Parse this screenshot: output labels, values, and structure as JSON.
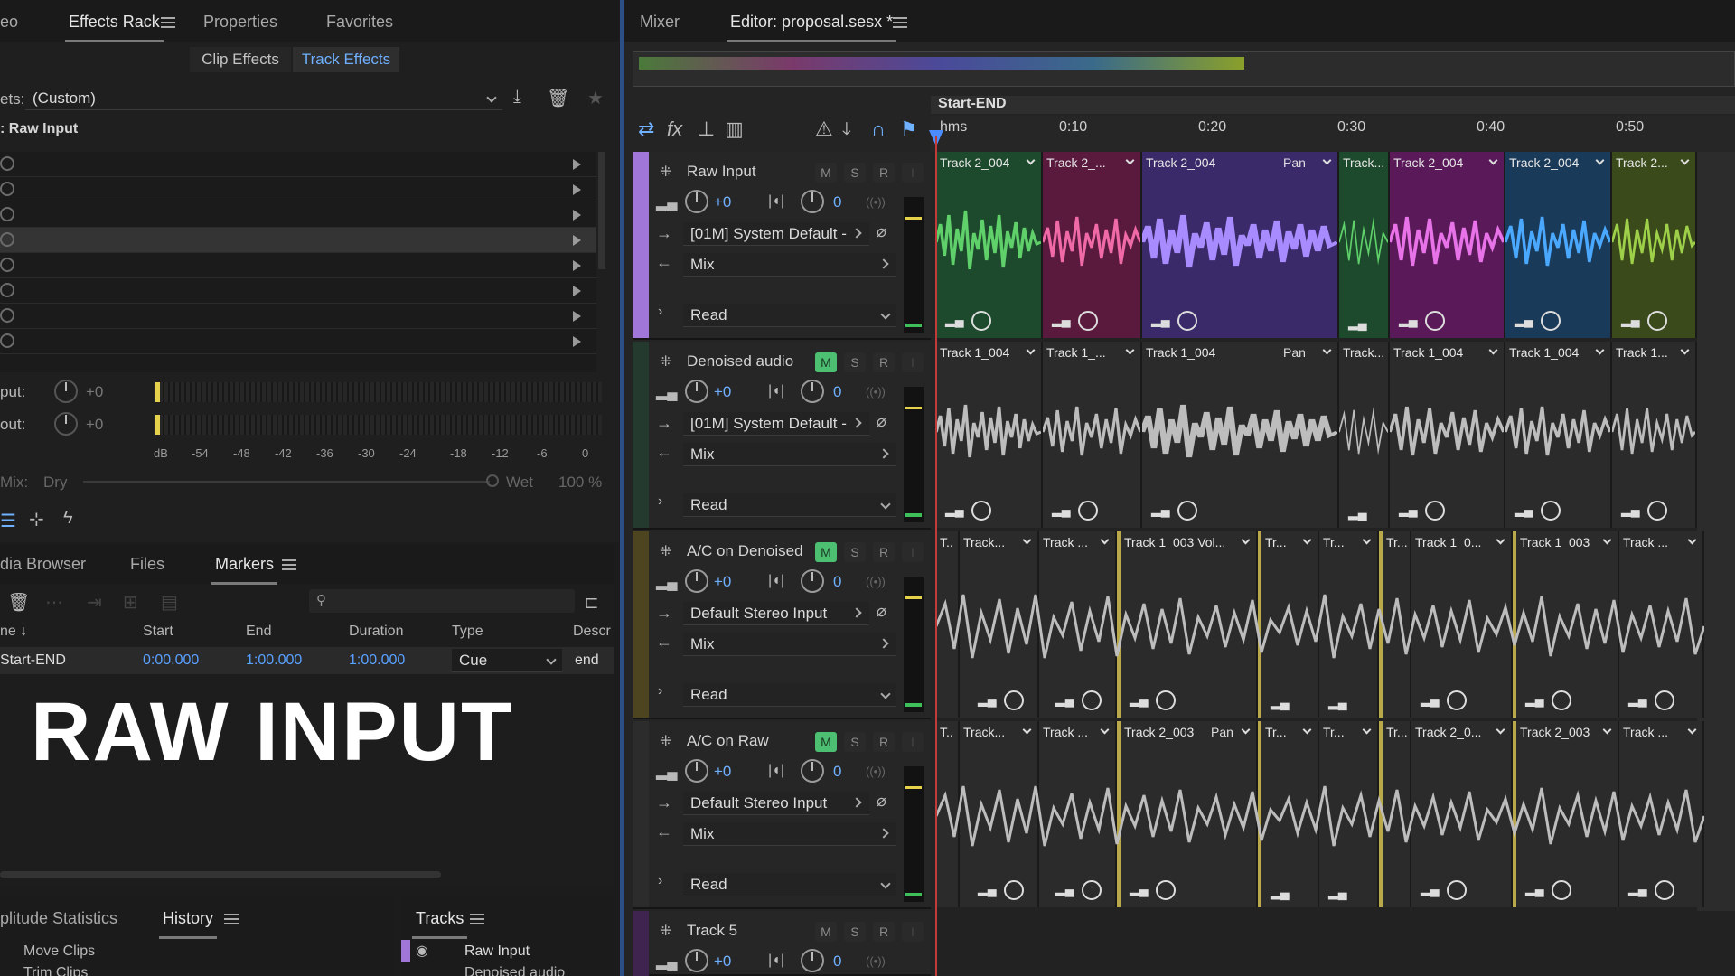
{
  "left_tabs": {
    "video": "eo",
    "effects_rack": "Effects Rack",
    "properties": "Properties",
    "favorites": "Favorites"
  },
  "subtabs": {
    "clip": "Clip Effects",
    "track": "Track Effects"
  },
  "presets": {
    "label": "ets:",
    "value": "(Custom)"
  },
  "rack_title": ": Raw Input",
  "io": {
    "input_label": "put:",
    "output_label": "out:",
    "input_val": "+0",
    "output_val": "+0"
  },
  "meter_scale": [
    "dB",
    "-54",
    "-48",
    "-42",
    "-36",
    "-30",
    "-24",
    "-18",
    "-12",
    "-6",
    "0"
  ],
  "mix": {
    "label": "Mix:",
    "dry": "Dry",
    "wet": "Wet",
    "pct": "100 %"
  },
  "bottom_tabs": {
    "media": "dia Browser",
    "files": "Files",
    "markers": "Markers"
  },
  "markers": {
    "headers": [
      "ne ↓",
      "Start",
      "End",
      "Duration",
      "Type",
      "Descr"
    ],
    "row": {
      "name": "Start-END",
      "start": "0:00.000",
      "end": "1:00.000",
      "duration": "1:00.000",
      "type": "Cue",
      "desc": "end"
    }
  },
  "overlay": "RAW INPUT",
  "lower_tabs": {
    "amp": "plitude Statistics",
    "history": "History",
    "tracks": "Tracks"
  },
  "history": [
    "Move Clips",
    "Trim Clips"
  ],
  "tracks_panel": [
    "Raw Input",
    "Denoised audio"
  ],
  "editor_tabs": {
    "mixer": "Mixer",
    "editor": "Editor: proposal.sesx *"
  },
  "range_label": "Start-END",
  "ruler": [
    "hms",
    "0:10",
    "0:20",
    "0:30",
    "0:40",
    "0:50"
  ],
  "track_controls": {
    "m": "M",
    "s": "S",
    "r": "R",
    "vol": "+0",
    "pan": "0",
    "out": "Mix",
    "auto": "Read"
  },
  "tracks": [
    {
      "name": "Raw Input",
      "input": "[01M] System Default -",
      "color": "#a077d8",
      "mute": false
    },
    {
      "name": "Denoised audio",
      "input": "[01M] System Default -",
      "color": "#2b4a3a",
      "mute": true
    },
    {
      "name": "A/C on Denoised",
      "input": "Default Stereo Input",
      "color": "#5a5020",
      "mute": true
    },
    {
      "name": "A/C on Raw",
      "input": "Default Stereo Input",
      "color": "#2a2a2a",
      "mute": true
    },
    {
      "name": "Track 5",
      "input": "",
      "color": "#4a2a5a",
      "mute": false
    }
  ],
  "clips": {
    "t1": [
      "Track 2_004",
      "Track 2_...",
      "Track 2_004",
      "Track...",
      "Track 2_004",
      "Track 2_004",
      "Track 2..."
    ],
    "t2": [
      "Track 1_004",
      "Track 1_...",
      "Track 1_004",
      "Track...",
      "Track 1_004",
      "Track 1_004",
      "Track 1..."
    ],
    "t3": [
      "T..",
      "Track...",
      "Track ...",
      "Track 1_003 Vol...",
      "Tr...",
      "Tr...",
      "Tr...",
      "Track 1_0...",
      "Track 1_003",
      "Track ..."
    ],
    "t4": [
      "T..",
      "Track...",
      "Track ...",
      "Track 2_003",
      "Tr...",
      "Tr...",
      "Tr...",
      "Track 2_0...",
      "Track 2_003",
      "Track ..."
    ],
    "pan": "Pan"
  }
}
